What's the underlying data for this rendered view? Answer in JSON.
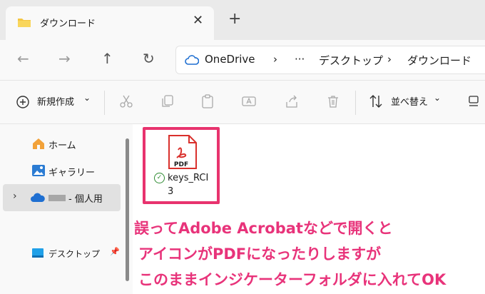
{
  "tab": {
    "title": "ダウンロード",
    "close": "✕",
    "new_tab": "+"
  },
  "nav": {
    "back": "←",
    "forward": "→",
    "up": "↑",
    "refresh": "↻"
  },
  "address": {
    "root": "OneDrive",
    "sep1": "›",
    "ellipsis": "···",
    "seg1": "デスクトップ",
    "sep2": "›",
    "seg2": "ダウンロード"
  },
  "commands": {
    "new_label": "新規作成",
    "new_chevron": "⌄",
    "sort_label": "並べ替え",
    "sort_chevron": "⌄"
  },
  "sidebar": {
    "items": [
      {
        "label": "ホーム"
      },
      {
        "label": "ギャラリー"
      },
      {
        "label": "- 個人用"
      },
      {
        "label": "デスクトップ"
      }
    ],
    "expand": "›",
    "pin": "📌"
  },
  "file": {
    "name_line1": "keys_RCI",
    "name_line2": "3",
    "icon_text": "PDF",
    "status": "✓"
  },
  "annotation": {
    "line1": "誤ってAdobe Acrobatなどで開くと",
    "line2": "アイコンがPDFになったりしますが",
    "line3": "このままインジケーターフォルダに入れてOK"
  },
  "colors": {
    "accent_pink": "#e8336e",
    "pdf_red": "#d9302c",
    "onedrive_blue": "#1f6fd1"
  }
}
